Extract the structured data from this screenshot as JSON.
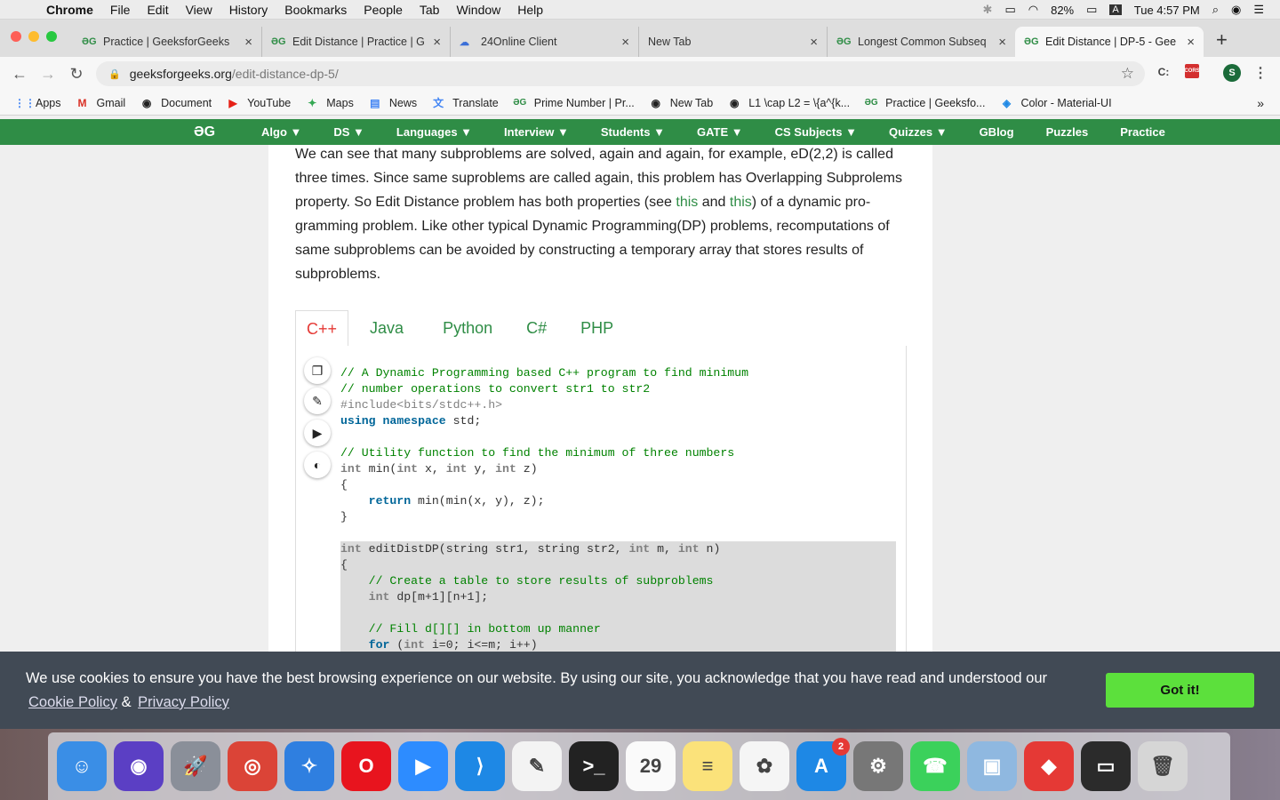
{
  "menubar": {
    "app": "Chrome",
    "items": [
      "File",
      "Edit",
      "View",
      "History",
      "Bookmarks",
      "People",
      "Tab",
      "Window",
      "Help"
    ],
    "battery": "82%",
    "input_source": "A",
    "clock": "Tue 4:57 PM"
  },
  "tabs": [
    {
      "title": "Practice | GeeksforGeeks",
      "favicon": "gfg-icon"
    },
    {
      "title": "Edit Distance | Practice | G",
      "favicon": "gfg-icon"
    },
    {
      "title": "24Online Client",
      "favicon": "cloud-icon"
    },
    {
      "title": "New Tab",
      "favicon": ""
    },
    {
      "title": "Longest Common Subseq",
      "favicon": "gfg-icon"
    },
    {
      "title": "Edit Distance | DP-5 - Gee",
      "favicon": "gfg-icon"
    }
  ],
  "address": {
    "host": "geeksforgeeks.org",
    "path": "/edit-distance-dp-5/"
  },
  "bookmarks": [
    {
      "label": "Apps",
      "icon": "apps-grid-icon"
    },
    {
      "label": "Gmail",
      "icon": "gmail-icon"
    },
    {
      "label": "Document",
      "icon": "globe-icon"
    },
    {
      "label": "YouTube",
      "icon": "youtube-icon"
    },
    {
      "label": "Maps",
      "icon": "maps-icon"
    },
    {
      "label": "News",
      "icon": "news-icon"
    },
    {
      "label": "Translate",
      "icon": "translate-icon"
    },
    {
      "label": "Prime Number | Pr...",
      "icon": "gfg-icon"
    },
    {
      "label": "New Tab",
      "icon": "globe-icon"
    },
    {
      "label": "L1 \\cap L2 = \\{a^{k...",
      "icon": "globe-icon"
    },
    {
      "label": "Practice | Geeksfo...",
      "icon": "gfg-icon"
    },
    {
      "label": "Color - Material-UI",
      "icon": "material-ui-icon"
    }
  ],
  "gfgnav": {
    "logo": "ƏG",
    "items": [
      "Algo ▼",
      "DS ▼",
      "Languages ▼",
      "Interview ▼",
      "Students ▼",
      "GATE ▼",
      "CS Subjects ▼",
      "Quizzes ▼",
      "GBlog",
      "Puzzles",
      "Practice"
    ]
  },
  "article": {
    "p1": "We can see that many subproblems are solved, again and again, for example, eD(2,2) is called three times. Since same suproblems are called again, this problem has Overlapping Subprolems property. So Edit Distance problem has both properties (see ",
    "link1": "this",
    "and": " and ",
    "link2": "this",
    "p2": ") of a dynamic pro-gramming problem. Like other typical Dynamic Programming(DP) problems, recomputations of same subproblems can be avoided by constructing a temporary array that stores results of subproblems."
  },
  "code_tabs": [
    "C++",
    "Java",
    "Python",
    "C#",
    "PHP"
  ],
  "code_lines": [
    {
      "text": "// A Dynamic Programming based C++ program to find minimum",
      "cls": "cm"
    },
    {
      "text": "// number operations to convert str1 to str2",
      "cls": "cm"
    },
    {
      "text": "#include<bits/stdc++.h>",
      "cls": "pp"
    },
    {
      "parts": [
        [
          "kw",
          "using"
        ],
        [
          "",
          " "
        ],
        [
          "kw",
          "namespace"
        ],
        [
          "",
          " std;"
        ]
      ]
    },
    {
      "text": "",
      "cls": ""
    },
    {
      "text": "// Utility function to find the minimum of three numbers",
      "cls": "cm"
    },
    {
      "parts": [
        [
          "ty",
          "int"
        ],
        [
          "",
          " min("
        ],
        [
          "ty",
          "int"
        ],
        [
          "",
          " x, "
        ],
        [
          "ty",
          "int"
        ],
        [
          "",
          " y, "
        ],
        [
          "ty",
          "int"
        ],
        [
          "",
          " z)"
        ]
      ]
    },
    {
      "text": "{",
      "cls": ""
    },
    {
      "parts": [
        [
          "",
          "    "
        ],
        [
          "kw",
          "return"
        ],
        [
          "",
          " min(min(x, y), z);"
        ]
      ]
    },
    {
      "text": "}",
      "cls": ""
    },
    {
      "text": "",
      "cls": ""
    },
    {
      "parts": [
        [
          "ty",
          "int"
        ],
        [
          "",
          " editDistDP(string str1, string str2, "
        ],
        [
          "ty",
          "int"
        ],
        [
          "",
          " m, "
        ],
        [
          "ty",
          "int"
        ],
        [
          "",
          " n)"
        ]
      ],
      "hl": true
    },
    {
      "text": "{",
      "cls": "",
      "hl": true
    },
    {
      "parts": [
        [
          "",
          "    "
        ],
        [
          "cm",
          "// Create a table to store results of subproblems"
        ]
      ],
      "hl": true
    },
    {
      "parts": [
        [
          "",
          "    "
        ],
        [
          "ty",
          "int"
        ],
        [
          "",
          " dp[m+1][n+1];"
        ]
      ],
      "hl": true
    },
    {
      "text": "",
      "cls": "",
      "hl": true
    },
    {
      "parts": [
        [
          "",
          "    "
        ],
        [
          "cm",
          "// Fill d[][] in bottom up manner"
        ]
      ],
      "hl": true
    },
    {
      "parts": [
        [
          "",
          "    "
        ],
        [
          "kw",
          "for"
        ],
        [
          "",
          " ("
        ],
        [
          "ty",
          "int"
        ],
        [
          "",
          " i=0; i<=m; i++)"
        ]
      ],
      "hl": true
    }
  ],
  "cookie": {
    "text": "We use cookies to ensure you have the best browsing experience on our website. By using our site, you acknowledge that you have read and understood our",
    "policy": "Cookie Policy",
    "amp": "&",
    "privacy": "Privacy Policy",
    "button": "Got it!"
  },
  "dock": [
    {
      "name": "finder-icon",
      "color": "#3a8ee6",
      "glyph": "☺"
    },
    {
      "name": "siri-icon",
      "color": "#5b3fc4",
      "glyph": "◉"
    },
    {
      "name": "launchpad-icon",
      "color": "#8a8f99",
      "glyph": "🚀"
    },
    {
      "name": "chrome-icon",
      "color": "#db4437",
      "glyph": "◎"
    },
    {
      "name": "safari-icon",
      "color": "#2f7fe0",
      "glyph": "✧"
    },
    {
      "name": "opera-icon",
      "color": "#e8141e",
      "glyph": "O"
    },
    {
      "name": "zoom-icon",
      "color": "#2d8cff",
      "glyph": "▶"
    },
    {
      "name": "vscode-icon",
      "color": "#1e88e5",
      "glyph": "⟩"
    },
    {
      "name": "textedit-icon",
      "color": "#f3f3f3",
      "glyph": "✎"
    },
    {
      "name": "terminal-icon",
      "color": "#222",
      "glyph": ">_"
    },
    {
      "name": "calendar-icon",
      "color": "#fafafa",
      "glyph": "29"
    },
    {
      "name": "notes-icon",
      "color": "#fbe27a",
      "glyph": "≡"
    },
    {
      "name": "photos-icon",
      "color": "#f5f5f5",
      "glyph": "✿"
    },
    {
      "name": "appstore-icon",
      "color": "#1e88e5",
      "glyph": "A",
      "badge": "2"
    },
    {
      "name": "system-preferences-icon",
      "color": "#777",
      "glyph": "⚙"
    },
    {
      "name": "facetime-icon",
      "color": "#3bd15b",
      "glyph": "☎"
    },
    {
      "name": "preview-icon",
      "color": "#8fb8e0",
      "glyph": "▣"
    },
    {
      "name": "anydesk-icon",
      "color": "#e53935",
      "glyph": "◆"
    },
    {
      "name": "terminal-window-icon",
      "color": "#2b2b2b",
      "glyph": "▭"
    },
    {
      "name": "trash-icon",
      "color": "#d6d6d6",
      "glyph": "🗑"
    }
  ],
  "colors": {
    "gfg_green": "#2f8d46",
    "cookie_bg": "#414a55",
    "gotit": "#5ce03c"
  }
}
